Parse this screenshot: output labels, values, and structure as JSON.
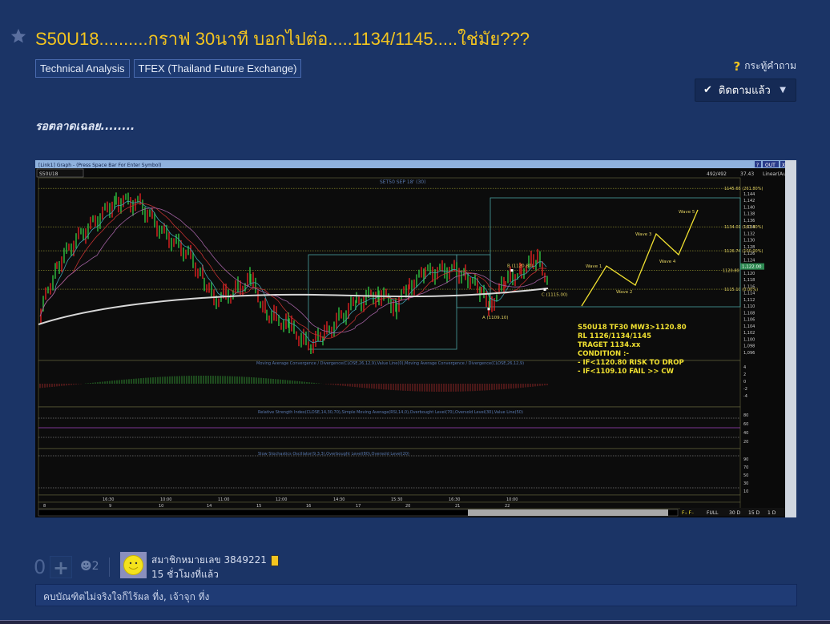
{
  "topic": {
    "title": "S50U18..........กราฟ 30นาที บอกไปต่อ.....1134/1145.....ใช่มัย???",
    "tags": [
      "Technical Analysis",
      "TFEX (Thailand Future Exchange)"
    ],
    "question_type": "กระทู้คำถาม",
    "follow_label": "ติดตามแล้ว",
    "body": "รอตลาดเฉลย........"
  },
  "chart_image": {
    "window_title": "[Link1] Graph - (Press Space Bar For Enter Symbol)",
    "symbol": "S50U18",
    "count": "492/492",
    "value": "37.43",
    "scale": "Linear(Auto)",
    "buttons": [
      "?",
      "OUT",
      "X"
    ],
    "main_title": "SET50 SEP 18' (30)",
    "price_ticks": [
      "1,144",
      "1,142",
      "1,140",
      "1,138",
      "1,136",
      "1,134",
      "1,132",
      "1,130",
      "1,128",
      "1,126",
      "1,124",
      "1,122",
      "1,120",
      "1,118",
      "1,116",
      "1,114",
      "1,112",
      "1,110",
      "1,108",
      "1,106",
      "1,104",
      "1,102",
      "1,100",
      "1,098",
      "1,096"
    ],
    "fib_labels": [
      "1145.65 (261.80%)",
      "1134.01 (161.80%)",
      "1126.74 (100.00%)",
      "1120.80",
      "1115.10 (0.00%)"
    ],
    "last_price": "1,122.00",
    "points": [
      "A (1109.10)",
      "B (1120.80)",
      "C (1115.00)"
    ],
    "waves": [
      "Wave 1",
      "Wave 2",
      "Wave 3",
      "Wave 4",
      "Wave 5"
    ],
    "annotation": [
      "S50U18 TF30 MW3>1120.80",
      "RL 1126/1134/1145",
      "TRAGET 1134.xx",
      "CONDITION :-",
      "- IF<1120.80 RISK TO DROP",
      "- IF<1109.10 FAIL >> CW"
    ],
    "macd_title": "Moving Average Convergence / Divergence(CLOSE,26,12,9),Value Line(0),Moving Average Convergence / Divergence(CLOSE,26,12,9)",
    "macd_ticks": [
      "4",
      "2",
      "0",
      "-2",
      "-4"
    ],
    "rsi_title": "Relative Strength Index(CLOSE,14,30,70),Simple Moving Average(RSI,14,0),Overbought Level(70),Oversold Level(30),Value Line(50)",
    "rsi_ticks": [
      "80",
      "60",
      "40",
      "20"
    ],
    "stoch_title": "Slow Stochastics Oscillator(9,3,3),Overbought Level(80),Oversold Level(20)",
    "stoch_ticks": [
      "90",
      "70",
      "50",
      "30",
      "10"
    ],
    "time_labels": [
      "16:30",
      "10:00",
      "11:00",
      "12:00",
      "14:30",
      "15:30",
      "16:30",
      "10:00"
    ],
    "date_labels": [
      "8",
      "9",
      "10",
      "14",
      "15",
      "16",
      "17",
      "20",
      "21",
      "22"
    ],
    "range_buttons": [
      "FULL",
      "30 D",
      "15 D",
      "1 D"
    ]
  },
  "reply": {
    "score": "0",
    "emotion_count": "2",
    "member": "สมาชิกหมายเลข 3849221",
    "time": "15 ชั่วโมงที่แล้ว",
    "signature": "คบบัณฑิตไม่จริงใจก็ไร้ผล ที่ง, เจ้าจุก ที่ง"
  },
  "colors": {
    "background": "#1b3466",
    "title": "#f4c51f",
    "chart_annotation": "#f0e030"
  }
}
